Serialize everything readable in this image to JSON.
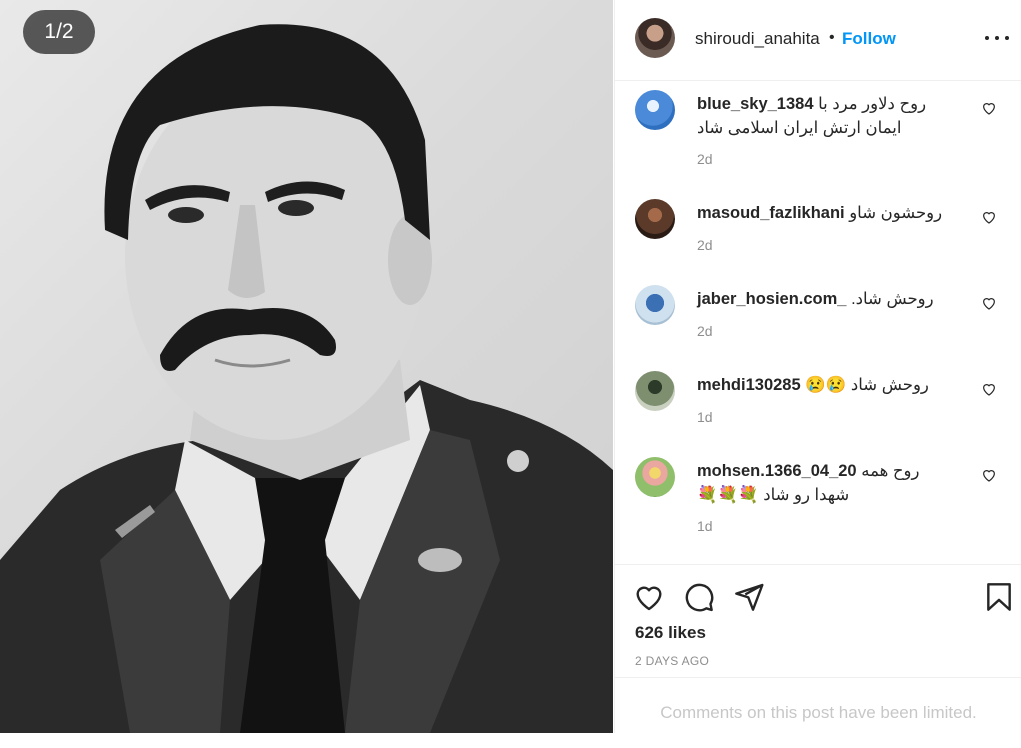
{
  "image": {
    "counter": "1/2"
  },
  "header": {
    "username": "shiroudi_anahita",
    "separator": "•",
    "follow_label": "Follow"
  },
  "comments": [
    {
      "username": "blue_sky_1384",
      "text": "روح دلاور مرد با",
      "text2": "ایمان ارتش ایران اسلامی شاد",
      "time": "2d"
    },
    {
      "username": "masoud_fazlikhani",
      "text": "روحشون شاو",
      "time": "2d"
    },
    {
      "username": "jaber_hosien.com_",
      "text": "روحش شاد.",
      "time": "2d"
    },
    {
      "username": "mehdi130285",
      "text": "روحش شاد 😢😢",
      "time": "1d"
    },
    {
      "username": "mohsen.1366_04_20",
      "text": "روح همه",
      "text2": "شهدا رو شاد 💐💐💐",
      "time": "1d"
    }
  ],
  "stats": {
    "likes": "626 likes",
    "date": "2 DAYS AGO"
  },
  "footer": {
    "limited_text": "Comments on this post have been limited."
  },
  "colors": {
    "accent": "#0095f6",
    "secondary_text": "#8e8e8e"
  }
}
